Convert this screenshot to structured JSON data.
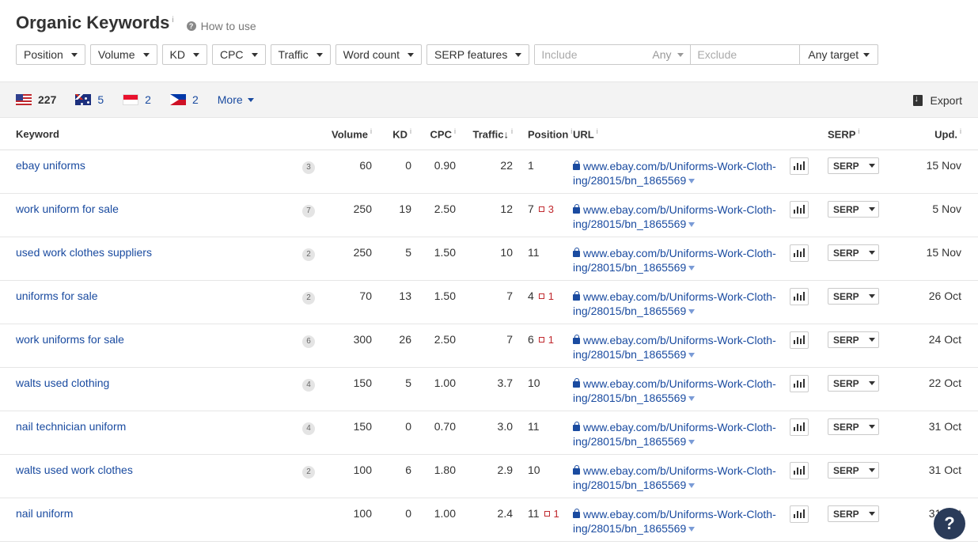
{
  "header": {
    "title": "Organic Keywords",
    "info_mark": "i",
    "how_to_use": "How to use"
  },
  "filters": {
    "position": "Position",
    "volume": "Volume",
    "kd": "KD",
    "cpc": "CPC",
    "traffic": "Traffic",
    "word_count": "Word count",
    "serp_features": "SERP features",
    "include_placeholder": "Include",
    "any": "Any",
    "exclude_placeholder": "Exclude",
    "target": "Any target"
  },
  "countries": [
    {
      "flag": "us-flag-icon",
      "count": "227"
    },
    {
      "flag": "au-flag-icon",
      "count": "5"
    },
    {
      "flag": "id-flag-icon",
      "count": "2"
    },
    {
      "flag": "ph-flag-icon",
      "count": "2"
    }
  ],
  "more": "More",
  "export": "Export",
  "columns": {
    "keyword": "Keyword",
    "volume": "Volume",
    "kd": "KD",
    "cpc": "CPC",
    "traffic": "Traffic",
    "sort_arrow": "↓",
    "position": "Position",
    "url": "URL",
    "serp": "SERP",
    "upd": "Upd.",
    "info": "i"
  },
  "serp_label": "SERP",
  "rows": [
    {
      "keyword": "ebay uniforms",
      "words": "3",
      "volume": "60",
      "kd": "0",
      "cpc": "0.90",
      "traffic": "22",
      "position": "1",
      "delta": "",
      "url1": "www.ebay.com/b/Uniforms-Work-Cloth-",
      "url2": "ing/28015/bn_1865569",
      "upd": "15 Nov"
    },
    {
      "keyword": "work uniform for sale",
      "words": "7",
      "volume": "250",
      "kd": "19",
      "cpc": "2.50",
      "traffic": "12",
      "position": "7",
      "delta": "3",
      "url1": "www.ebay.com/b/Uniforms-Work-Cloth-",
      "url2": "ing/28015/bn_1865569",
      "upd": "5 Nov"
    },
    {
      "keyword": "used work clothes suppliers",
      "words": "2",
      "volume": "250",
      "kd": "5",
      "cpc": "1.50",
      "traffic": "10",
      "position": "11",
      "delta": "",
      "url1": "www.ebay.com/b/Uniforms-Work-Cloth-",
      "url2": "ing/28015/bn_1865569",
      "upd": "15 Nov"
    },
    {
      "keyword": "uniforms for sale",
      "words": "2",
      "volume": "70",
      "kd": "13",
      "cpc": "1.50",
      "traffic": "7",
      "position": "4",
      "delta": "1",
      "url1": "www.ebay.com/b/Uniforms-Work-Cloth-",
      "url2": "ing/28015/bn_1865569",
      "upd": "26 Oct"
    },
    {
      "keyword": "work uniforms for sale",
      "words": "6",
      "volume": "300",
      "kd": "26",
      "cpc": "2.50",
      "traffic": "7",
      "position": "6",
      "delta": "1",
      "url1": "www.ebay.com/b/Uniforms-Work-Cloth-",
      "url2": "ing/28015/bn_1865569",
      "upd": "24 Oct"
    },
    {
      "keyword": "walts used clothing",
      "words": "4",
      "volume": "150",
      "kd": "5",
      "cpc": "1.00",
      "traffic": "3.7",
      "position": "10",
      "delta": "",
      "url1": "www.ebay.com/b/Uniforms-Work-Cloth-",
      "url2": "ing/28015/bn_1865569",
      "upd": "22 Oct"
    },
    {
      "keyword": "nail technician uniform",
      "words": "4",
      "volume": "150",
      "kd": "0",
      "cpc": "0.70",
      "traffic": "3.0",
      "position": "11",
      "delta": "",
      "url1": "www.ebay.com/b/Uniforms-Work-Cloth-",
      "url2": "ing/28015/bn_1865569",
      "upd": "31 Oct"
    },
    {
      "keyword": "walts used work clothes",
      "words": "2",
      "volume": "100",
      "kd": "6",
      "cpc": "1.80",
      "traffic": "2.9",
      "position": "10",
      "delta": "",
      "url1": "www.ebay.com/b/Uniforms-Work-Cloth-",
      "url2": "ing/28015/bn_1865569",
      "upd": "31 Oct"
    },
    {
      "keyword": "nail uniform",
      "words": "",
      "volume": "100",
      "kd": "0",
      "cpc": "1.00",
      "traffic": "2.4",
      "position": "11",
      "delta": "1",
      "url1": "www.ebay.com/b/Uniforms-Work-Cloth-",
      "url2": "ing/28015/bn_1865569",
      "upd": "31 Oct"
    }
  ],
  "help_label": "?"
}
